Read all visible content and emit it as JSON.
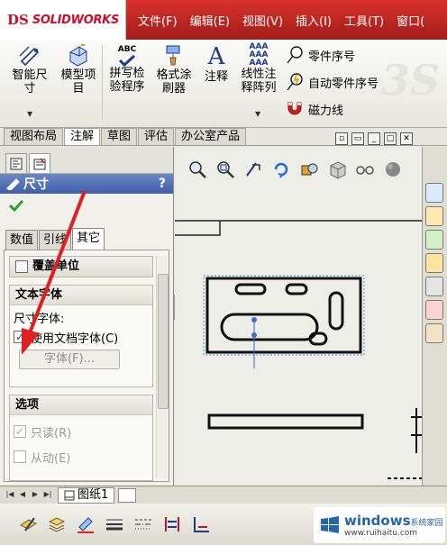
{
  "app": {
    "logo_ds": "DS",
    "logo_name": "SOLIDWORKS"
  },
  "menubar": [
    "文件(F)",
    "编辑(E)",
    "视图(V)",
    "插入(I)",
    "工具(T)",
    "窗口("
  ],
  "ribbon": {
    "smart_dim_l1": "智能尺",
    "smart_dim_l2": "寸",
    "model_items_l1": "模型项",
    "model_items_l2": "目",
    "spell_l1": "拼写检",
    "spell_l2": "验程序",
    "format_l1": "格式涂",
    "format_l2": "刷器",
    "note": "注释",
    "pattern_l1": "线性注",
    "pattern_l2": "释阵列",
    "balloon": "零件序号",
    "auto_balloon": "自动零件序号",
    "magnetic_line": "磁力线",
    "spell_abc": "ABC",
    "pattern_aaa": "AAA"
  },
  "cm_tabs": [
    "视图布局",
    "注解",
    "草图",
    "评估",
    "办公室产品"
  ],
  "cm_active": "注解",
  "property_manager": {
    "title": "尺寸",
    "help": "?",
    "subtabs": [
      "数值",
      "引线",
      "其它"
    ],
    "subtab_active": "其它",
    "override_units": "覆盖单位",
    "text_font_header": "文本字体",
    "dim_font_label": "尺寸字体:",
    "use_doc_font": "使用文档字体(C)",
    "use_doc_font_checked": true,
    "font_button": "字体(F)...",
    "options_header": "选项",
    "read_only": "只读(R)",
    "read_only_checked": true,
    "driven": "从动(E)",
    "driven_checked": false
  },
  "sheet_tab": "图纸1",
  "watermark": {
    "title": "windows",
    "subtitle": "系统家园",
    "url": "www.ruihaitu.com"
  },
  "colors": {
    "accent_red": "#c8102e",
    "header_blue": "#3f5fa7",
    "arrow_red": "#e02020"
  }
}
